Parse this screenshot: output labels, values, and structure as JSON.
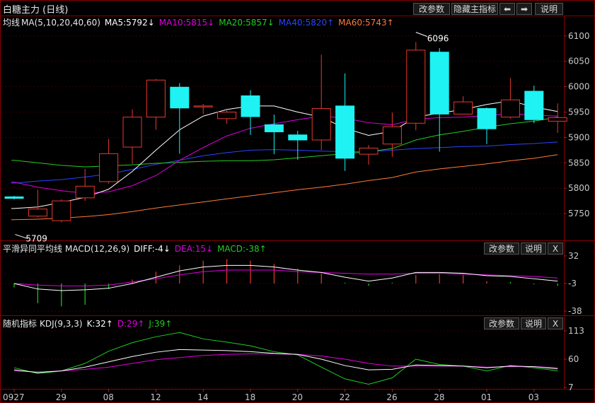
{
  "title": "白糖主力 (日线)",
  "header_buttons": {
    "params": "改参数",
    "hide_indicator": "隐藏主指标",
    "prev": "⬅",
    "next": "➡",
    "help": "说明"
  },
  "panel_buttons": {
    "params": "改参数",
    "help": "说明",
    "close": "X"
  },
  "colors": {
    "up": "#e8392f",
    "down": "#1ef2f2",
    "ma5": "#ffffff",
    "ma10": "#e000e0",
    "ma20": "#22cc22",
    "ma40": "#2a44ff",
    "ma60": "#ff7a3a",
    "dif": "#ffffff",
    "dea": "#e000e0",
    "macd_pos": "#e8392f",
    "macd_neg": "#22cc22",
    "k": "#ffffff",
    "d": "#e000e0",
    "j": "#22cc22",
    "grid": "#3a0000",
    "frame": "#8a0000"
  },
  "ma_legend": {
    "name": "均线",
    "params": "MA(5,10,20,40,60)",
    "ma5": "MA5:5792↓",
    "ma10": "MA10:5815↓",
    "ma20": "MA20:5857↓",
    "ma40": "MA40:5820↑",
    "ma60": "MA60:5743↑"
  },
  "macd_legend": {
    "name": "平滑异同平均线",
    "params": "MACD(12,26,9)",
    "dif": "DIFF:-4↓",
    "dea": "DEA:15↓",
    "macd": "MACD:-38↑"
  },
  "kdj_legend": {
    "name": "随机指标",
    "params": "KDJ(9,3,3)",
    "k": "K:32↑",
    "d": "D:29↑",
    "j": "J:39↑"
  },
  "price_axis": {
    "labels": [
      "6100",
      "6050",
      "6000",
      "5950",
      "5900",
      "5850",
      "5800",
      "5750"
    ],
    "values": [
      6100,
      6050,
      6000,
      5950,
      5900,
      5850,
      5800,
      5750
    ]
  },
  "macd_axis": {
    "labels": [
      "32",
      "-3",
      "-38"
    ],
    "values": [
      32,
      -3,
      -38
    ]
  },
  "kdj_axis": {
    "labels": [
      "113",
      "60",
      "7"
    ],
    "values": [
      113,
      60,
      7
    ]
  },
  "date_labels": [
    "0927",
    "29",
    "08",
    "12",
    "14",
    "18",
    "20",
    "22",
    "26",
    "28",
    "01",
    "03"
  ],
  "annotations": {
    "low": "5709",
    "high": "6096"
  },
  "chart_data": {
    "type": "candlestick",
    "price_range": [
      5700,
      6115
    ],
    "candles": [
      {
        "o": 5783,
        "c": 5780,
        "h": 5785,
        "l": 5778
      },
      {
        "o": 5745,
        "c": 5759,
        "h": 5797,
        "l": 5743
      },
      {
        "o": 5736,
        "c": 5775,
        "h": 5778,
        "l": 5733
      },
      {
        "o": 5781,
        "c": 5804,
        "h": 5838,
        "l": 5775
      },
      {
        "o": 5813,
        "c": 5868,
        "h": 5897,
        "l": 5809
      },
      {
        "o": 5881,
        "c": 5940,
        "h": 5955,
        "l": 5848
      },
      {
        "o": 5940,
        "c": 6013,
        "h": 6015,
        "l": 5915
      },
      {
        "o": 5999,
        "c": 5958,
        "h": 6007,
        "l": 5868
      },
      {
        "o": 5960,
        "c": 5962,
        "h": 5966,
        "l": 5946
      },
      {
        "o": 5937,
        "c": 5950,
        "h": 5953,
        "l": 5927
      },
      {
        "o": 5982,
        "c": 5941,
        "h": 5993,
        "l": 5905
      },
      {
        "o": 5925,
        "c": 5911,
        "h": 5945,
        "l": 5867
      },
      {
        "o": 5905,
        "c": 5895,
        "h": 5913,
        "l": 5856
      },
      {
        "o": 5895,
        "c": 5957,
        "h": 6063,
        "l": 5875
      },
      {
        "o": 5962,
        "c": 5859,
        "h": 6026,
        "l": 5834
      },
      {
        "o": 5867,
        "c": 5879,
        "h": 5885,
        "l": 5846
      },
      {
        "o": 5887,
        "c": 5921,
        "h": 5949,
        "l": 5862
      },
      {
        "o": 5928,
        "c": 6072,
        "h": 6088,
        "l": 5914
      },
      {
        "o": 6068,
        "c": 5946,
        "h": 6076,
        "l": 5872
      },
      {
        "o": 5946,
        "c": 5970,
        "h": 5981,
        "l": 5946
      },
      {
        "o": 5957,
        "c": 5917,
        "h": 5959,
        "l": 5887
      },
      {
        "o": 5940,
        "c": 5974,
        "h": 6017,
        "l": 5937
      },
      {
        "o": 5991,
        "c": 5935,
        "h": 6002,
        "l": 5928
      },
      {
        "o": 5932,
        "c": 5939,
        "h": 5967,
        "l": 5909
      }
    ],
    "ma5": [
      5760,
      5763,
      5772,
      5782,
      5798,
      5833,
      5875,
      5915,
      5942,
      5955,
      5962,
      5962,
      5950,
      5940,
      5918,
      5904,
      5912,
      5940,
      5948,
      5955,
      5965,
      5972,
      5960,
      5951
    ],
    "ma10": [
      5812,
      5802,
      5795,
      5790,
      5793,
      5805,
      5825,
      5855,
      5880,
      5903,
      5918,
      5927,
      5935,
      5942,
      5938,
      5929,
      5925,
      5936,
      5939,
      5940,
      5943,
      5947,
      5944,
      5942
    ],
    "ma20": [
      5855,
      5850,
      5845,
      5842,
      5844,
      5846,
      5849,
      5851,
      5853,
      5854,
      5854,
      5856,
      5860,
      5864,
      5868,
      5872,
      5878,
      5895,
      5905,
      5912,
      5920,
      5927,
      5932,
      5940
    ],
    "ma40": [
      5810,
      5814,
      5817,
      5822,
      5828,
      5837,
      5847,
      5855,
      5864,
      5870,
      5875,
      5876,
      5875,
      5873,
      5872,
      5872,
      5875,
      5878,
      5880,
      5882,
      5883,
      5886,
      5888,
      5891
    ],
    "ma60": [
      5738,
      5739,
      5741,
      5744,
      5748,
      5754,
      5761,
      5767,
      5773,
      5779,
      5785,
      5791,
      5797,
      5802,
      5808,
      5815,
      5821,
      5832,
      5838,
      5843,
      5848,
      5854,
      5859,
      5866
    ],
    "macd": {
      "range": [
        -38,
        32
      ],
      "dif": [
        -3,
        -10,
        -12,
        -11,
        -9,
        -3,
        5,
        13,
        18,
        20,
        20,
        18,
        14,
        11,
        5,
        0,
        4,
        11,
        11,
        10,
        7,
        6,
        3,
        0
      ],
      "dea": [
        -3,
        -5,
        -6,
        -6,
        -5,
        -1,
        3,
        8,
        12,
        14,
        14,
        14,
        12,
        11,
        10,
        9,
        9,
        10,
        10,
        9,
        8,
        7,
        6,
        4
      ],
      "bar": [
        -8,
        -28,
        -32,
        -30,
        -10,
        2,
        12,
        20,
        26,
        28,
        26,
        22,
        16,
        10,
        -2,
        -6,
        -2,
        8,
        9,
        8,
        0,
        -1,
        -4,
        -6
      ]
    },
    "kdj": {
      "range": [
        7,
        113
      ],
      "k": [
        40,
        35,
        38,
        45,
        55,
        65,
        73,
        78,
        77,
        76,
        74,
        71,
        69,
        60,
        48,
        40,
        41,
        49,
        48,
        47,
        44,
        47,
        46,
        42
      ],
      "d": [
        38,
        36,
        38,
        41,
        45,
        52,
        59,
        63,
        67,
        69,
        70,
        70,
        69,
        66,
        60,
        52,
        47,
        47,
        47,
        47,
        45,
        46,
        46,
        44
      ],
      "j": [
        44,
        33,
        38,
        52,
        75,
        91,
        102,
        110,
        98,
        92,
        85,
        74,
        68,
        45,
        23,
        13,
        25,
        60,
        50,
        47,
        38,
        48,
        44,
        38
      ]
    }
  }
}
